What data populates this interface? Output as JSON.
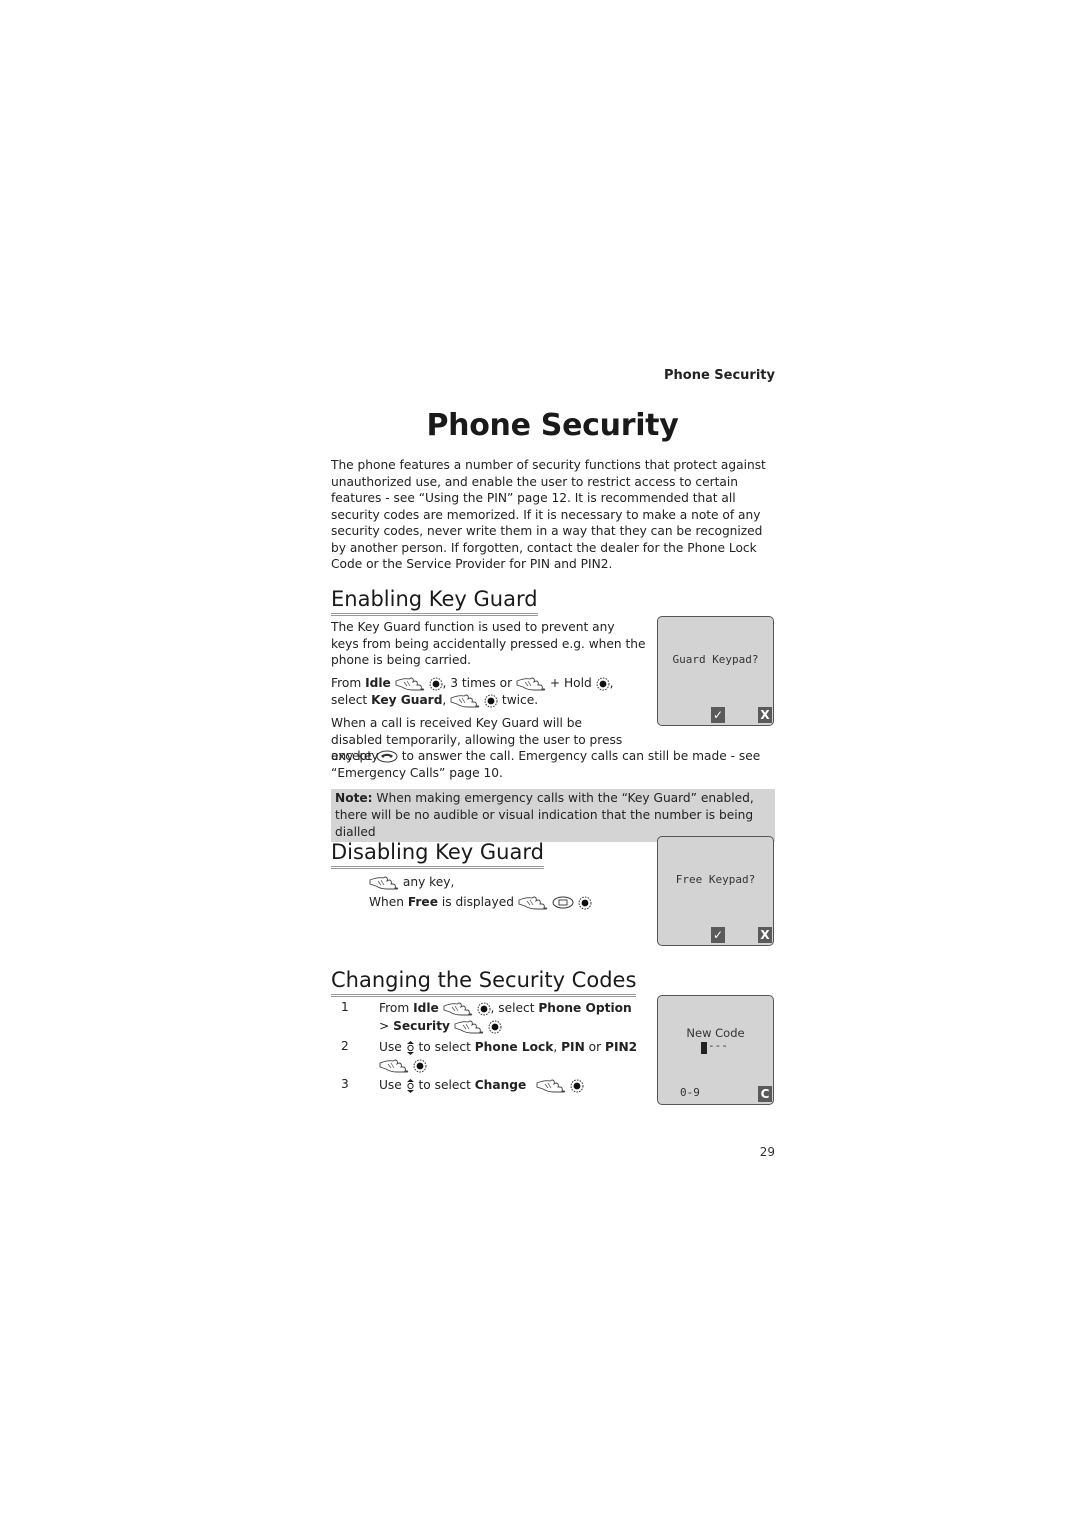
{
  "running_head": "Phone Security",
  "page_title": "Phone Security",
  "intro": "The phone features a number of security functions that protect against unauthorized use, and enable the user to restrict access to certain features - see “Using the PIN” page 12. It is recommended that all security codes are memorized. If it is necessary to make a note of any security codes, never write them in a way that they can be recognized by another person. If forgotten, contact the dealer for the Phone Lock Code or the Service Provider for PIN and PIN2.",
  "enabling": {
    "heading": "Enabling Key Guard",
    "para1": "The Key Guard function is used to prevent any keys from being accidentally pressed e.g. when the phone is being carried.",
    "line1": {
      "from": "From ",
      "idle": "Idle",
      "times": ", 3 times or ",
      "hold": " + Hold ",
      "comma": ","
    },
    "line2": {
      "select": "select ",
      "key_guard": "Key Guard",
      "comma": ",",
      "twice": " twice."
    },
    "para3a": "When a call is received Key Guard will be disabled temporarily, allowing the user to press any key",
    "para3b_except": "except ",
    "para3b_rest": " to answer the call. Emergency calls can still be made - see “Emergency Calls” page 10.",
    "screen": {
      "message": "Guard Keypad?",
      "left_softkey": "✓",
      "right_softkey": "X"
    }
  },
  "note": {
    "label": "Note:",
    "text": " When making emergency calls with the “Key Guard” enabled, there will be no audible or visual indication that the number is being dialled"
  },
  "disabling": {
    "heading": "Disabling Key Guard",
    "line1": " any key,",
    "line2_when": "When ",
    "line2_free": "Free",
    "line2_rest": " is displayed ",
    "screen": {
      "message": "Free Keypad?",
      "left_softkey": "✓",
      "right_softkey": "X"
    }
  },
  "changing": {
    "heading": "Changing the Security Codes",
    "steps": [
      {
        "num": "1",
        "from": "From ",
        "idle": "Idle",
        "select": ", select ",
        "phone_option": "Phone Option",
        "gt": "> ",
        "security": "Security"
      },
      {
        "num": "2",
        "use": "Use ",
        "to_select": " to select ",
        "phone_lock": "Phone Lock",
        "comma": ", ",
        "pin": "PIN",
        "or": " or ",
        "pin2": "PIN2"
      },
      {
        "num": "3",
        "use": "Use ",
        "to_select": " to select ",
        "change": "Change"
      }
    ],
    "screen": {
      "message": "New Code",
      "entry": "---",
      "hint": "0-9",
      "right_softkey": "C"
    }
  },
  "page_number": "29",
  "icons": {
    "hand": "hand-press-icon",
    "nav": "navigation-key-icon",
    "updown": "up-down-scroll-icon",
    "call": "call-key-icon",
    "menu": "menu-key-icon"
  },
  "colors": {
    "note_bg": "#d4d4d4",
    "screen_bg": "#d3d3d3",
    "softkey_bg": "#5a5a5a"
  }
}
